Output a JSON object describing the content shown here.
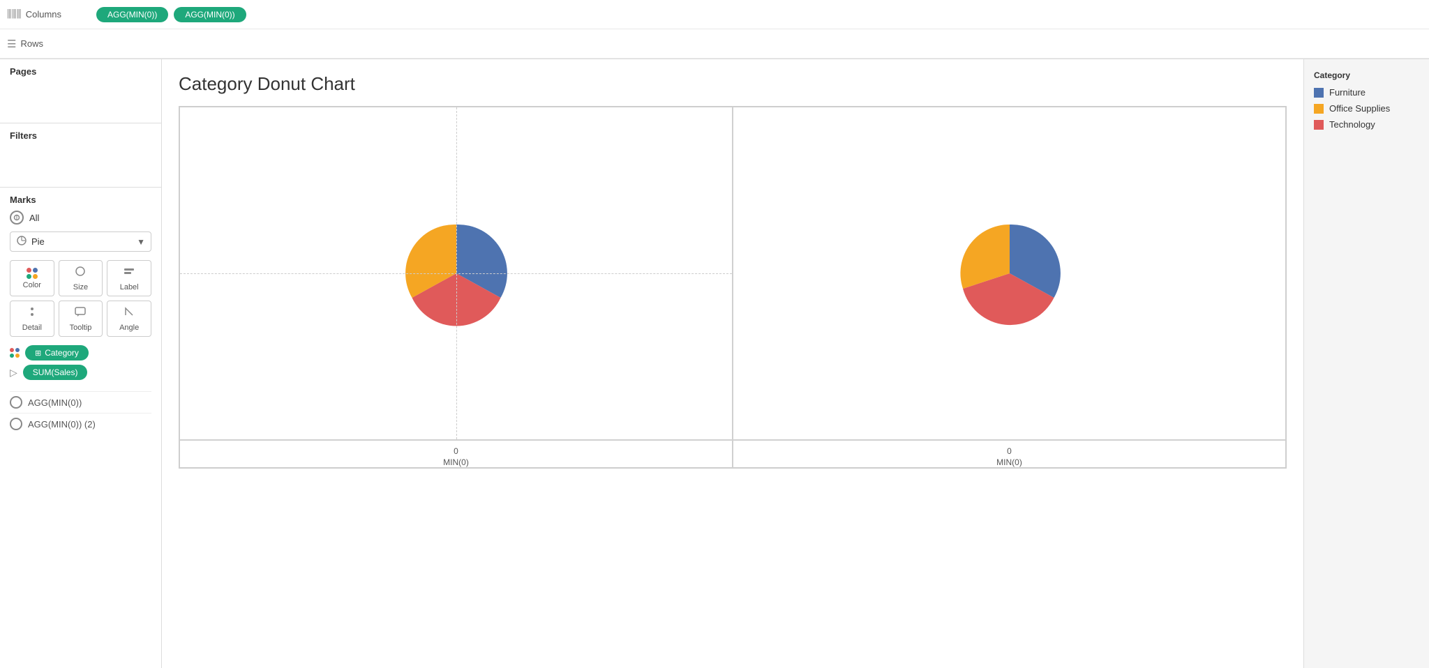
{
  "topShelf": {
    "columnsLabel": "Columns",
    "rowsLabel": "Rows",
    "pill1": "AGG(MIN(0))",
    "pill2": "AGG(MIN(0))"
  },
  "sidebar": {
    "pagesTitle": "Pages",
    "filtersTitle": "Filters",
    "marksTitle": "Marks",
    "allLabel": "All",
    "pieLabel": "Pie",
    "colorLabel": "Color",
    "sizeLabel": "Size",
    "labelLabel": "Label",
    "detailLabel": "Detail",
    "tooltipLabel": "Tooltip",
    "angleLabel": "Angle",
    "categoryPill": "Category",
    "sumSalesPill": "SUM(Sales)",
    "agg1": "AGG(MIN(0))",
    "agg2": "AGG(MIN(0)) (2)"
  },
  "chart": {
    "title": "Category Donut Chart",
    "axisValue1": "0",
    "axisLabel1": "MIN(0)",
    "axisValue2": "0",
    "axisLabel2": "MIN(0)"
  },
  "legend": {
    "title": "Category",
    "items": [
      {
        "label": "Furniture",
        "color": "#4e73b0"
      },
      {
        "label": "Office Supplies",
        "color": "#f5a623"
      },
      {
        "label": "Technology",
        "color": "#e05a5a"
      }
    ]
  },
  "pie1": {
    "furniture": 35,
    "officeSupplies": 30,
    "technology": 35,
    "colors": [
      "#4e73b0",
      "#f5a623",
      "#e05a5a"
    ]
  },
  "pie2": {
    "furniture": 35,
    "officeSupplies": 28,
    "technology": 37,
    "colors": [
      "#4e73b0",
      "#f5a623",
      "#e05a5a"
    ]
  }
}
